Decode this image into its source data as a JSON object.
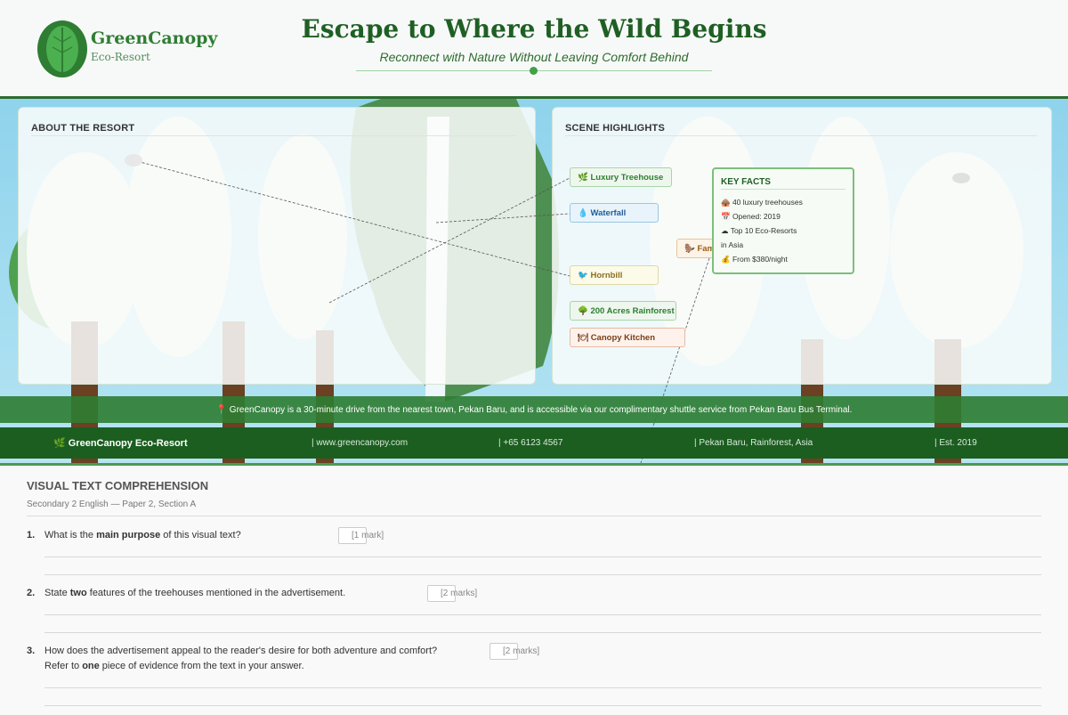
{
  "header": {
    "brand_name": "GreenCanopy",
    "brand_sub": "Eco-Resort",
    "title": "Escape to Where the Wild Begins",
    "subtitle": "Reconnect with Nature Without Leaving Comfort Behind"
  },
  "scene": {
    "about_title": "ABOUT THE RESORT",
    "highlights_title": "SCENE HIGHLIGHTS",
    "tags": {
      "treehouse": "🌿 Luxury Treehouse",
      "waterfall": "💧 Waterfall",
      "family": "🦫 Fam",
      "hornbill": "🐦 Hornbill",
      "rainforest": "🌳 200 Acres Rainforest",
      "kitchen": "🍽 Canopy Kitchen"
    },
    "facts": {
      "title": "KEY FACTS",
      "items": [
        "🛖 40 luxury treehouses",
        "📅 Opened: 2019",
        "☁ Top 10 Eco-Resorts",
        "in Asia",
        "💰 From $380/night"
      ]
    },
    "notice": "📍 GreenCanopy is a 30-minute drive from the nearest town, Pekan Baru, and is accessible via our complimentary shuttle service from Pekan Baru Bus Terminal."
  },
  "footer": {
    "brand": "🌿 GreenCanopy Eco-Resort",
    "web": "| www.greencanopy.com",
    "phone": "| +65 6123 4567",
    "location": "| Pekan Baru, Rainforest, Asia",
    "est": "| Est. 2019"
  },
  "questions": {
    "heading": "VISUAL TEXT COMPREHENSION",
    "sub": "Secondary 2 English — Paper 2, Section A",
    "items": [
      {
        "num": "1.",
        "pre": "What is the ",
        "bold": "main purpose",
        "post": " of this visual text?",
        "marks": "[1 mark]"
      },
      {
        "num": "2.",
        "pre": "State ",
        "bold": "two",
        "post": " features of the treehouses mentioned in the advertisement.",
        "marks": "[2 marks]"
      },
      {
        "num": "3.",
        "pre": "How does the advertisement appeal to the reader's desire for both adventure and comfort?",
        "line2_pre": "Refer to ",
        "bold": "one",
        "line2_post": " piece of evidence from the text in your answer.",
        "marks": "[2 marks]"
      }
    ]
  },
  "colors": {
    "brand_green": "#2e7d32",
    "dark_green": "#1b5e20",
    "sky": "#a9dff1"
  }
}
